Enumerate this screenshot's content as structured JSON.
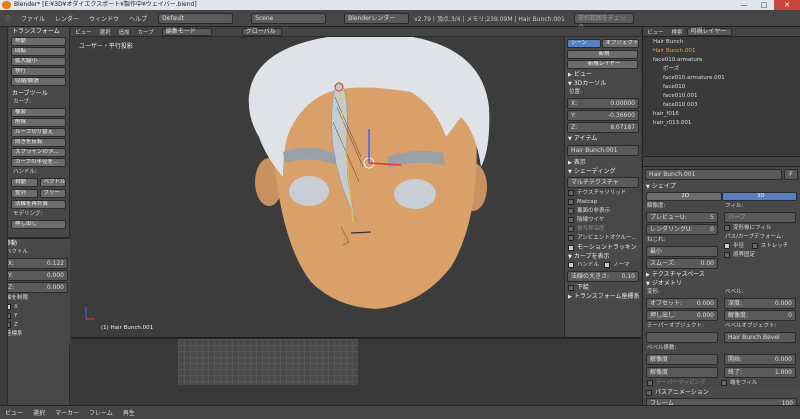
{
  "window": {
    "title": "Blender* [E:¥3D¥オダイエクスポート¥製作中¥ウェイバー.blend]",
    "min": "—",
    "max": "□",
    "close": "✕"
  },
  "menu": {
    "items": [
      "ファイル",
      "レンダー",
      "ウィンドウ",
      "ヘルプ"
    ],
    "layout": "Default",
    "scene": "Scene",
    "engine": "Blenderレンダー",
    "stats": "v2.79 | 頂点:3/4 | メモリ:239.09M | Hair Bunch.001",
    "mode_btn": "選択範囲をチェック"
  },
  "viewport": {
    "label": "ユーザー・平行投影",
    "object_label": "(1) Hair Bunch.001",
    "header_items": [
      "ビュー",
      "選択",
      "追加",
      "カーブ"
    ],
    "mode": "編集モード",
    "orientation": "グローバル"
  },
  "tool_shelf": {
    "header": "トランスフォーム",
    "transform": [
      "移動",
      "回転",
      "拡大縮小",
      "移行",
      "収縮/膨張"
    ],
    "curve_tools_header": "カーブツール",
    "curve_label": "カーブ:",
    "curve_buttons": [
      "複製",
      "削除",
      "ループ切り替え",
      "向きを反転",
      "スプラインのタ…",
      "カーブの半径を…"
    ],
    "handle_label": "ハンドル:",
    "handle_buttons": [
      "自動",
      "ベクトル",
      "整列",
      "フリー"
    ],
    "extra_buttons": [
      "法線を再計算",
      "モデリング:",
      "押し出し"
    ]
  },
  "operator_panel": {
    "header": "移動",
    "vector_label": "ベクトル",
    "x": "X:",
    "xv": "0.122",
    "y": "Y:",
    "yv": "0.000",
    "z": "Z:",
    "zv": "0.000",
    "constraint_label": "軸を制限",
    "axes": [
      "X",
      "Y",
      "Z"
    ],
    "orient_label": "座標系"
  },
  "view_panel": {
    "tabs": [
      "シーン",
      "オブジェクト"
    ],
    "new": "新規",
    "new_layer": "新規レイヤー",
    "view": "ビュー",
    "cursor": "3Dカーソル",
    "location": "位置:",
    "cx": "X:",
    "cxv": "0.00000",
    "cy": "Y:",
    "cyv": "-0.36600",
    "cz": "Z:",
    "czv": "8.07187",
    "item": "アイテム",
    "item_name": "Hair Bunch.001",
    "display": "表示",
    "shading": "シェーディング",
    "shading_mode": "マルチテクスチャ",
    "options": [
      "テクスチャソリッド",
      "Matcap",
      "裏面の非表示",
      "陰線ワイヤ",
      "被写界深度",
      "アンビエントオクルー..."
    ],
    "motion": "モーショントラッキン",
    "curve_display": "カーブを表示",
    "handles": "ハンドル",
    "normals": "ノーマ",
    "normal_size": "法線の大きさ:",
    "normal_size_val": "0.10",
    "background": "下絵",
    "transform_orient": "トランスフォーム座標系"
  },
  "outliner": {
    "header_items": [
      "ビュー",
      "検索",
      "可視レイヤー"
    ],
    "rows": [
      {
        "name": "Hair Bunch",
        "indent": 0
      },
      {
        "name": "Hair Bunch.001",
        "indent": 0
      },
      {
        "name": "face010.armature",
        "indent": 0
      },
      {
        "name": "ポーズ",
        "indent": 1
      },
      {
        "name": "face010.armature.001",
        "indent": 1
      },
      {
        "name": "face010",
        "indent": 1
      },
      {
        "name": "face010.001",
        "indent": 1
      },
      {
        "name": "face010.003",
        "indent": 1
      },
      {
        "name": "hair_f016",
        "indent": 0
      },
      {
        "name": "hair_r013.001",
        "indent": 0
      }
    ]
  },
  "properties": {
    "name": "Hair Bunch.001",
    "f": "F",
    "shape": "シェイプ",
    "d2": "2D",
    "d3": "3D",
    "resolution": "解像度:",
    "preview_u": "プレビューU:",
    "preview_u_v": "5",
    "render_u": "レンダリングU:",
    "render_u_v": "0",
    "fill": "フィル:",
    "fill_val": "ハーフ",
    "fill_deform": "変形後にフィル",
    "twist": "ねじれ:",
    "twist_val": "最小",
    "smooth": "スムーズ:",
    "smooth_v": "0.00",
    "path_deform": "パス/カーブデフォーム:",
    "radius": "半径",
    "stretch": "ストレッチ",
    "bounds": "境界固定",
    "texspace": "テクスチャスペース",
    "geometry": "ジオメトリ",
    "modify": "変形:",
    "offset": "オフセット:",
    "offset_v": "0.000",
    "extrude": "押し出し:",
    "extrude_v": "0.000",
    "bevel": "ベベル:",
    "depth": "深度:",
    "depth_v": "0.000",
    "resolution2": "解像度:",
    "res2_v": "0",
    "taper": "テーパーオブジェクト:",
    "bevel_obj": "ベベルオブジェクト:",
    "bevel_obj_val": "Hair Bunch Bevel",
    "bevel_factor": "ベベル係数:",
    "res_a": "解像度",
    "start": "開始:",
    "start_v": "0.000",
    "res_b": "解像度",
    "end": "終了:",
    "end_v": "1.000",
    "taper_map": "テーパーマッピング",
    "fill_caps": "端をフィル",
    "path_anim": "パスアニメーション",
    "frames": "フレーム",
    "frames_v": "100"
  },
  "status": {
    "items": [
      "ビュー",
      "選択",
      "マーカー",
      "フレーム",
      "再生"
    ]
  }
}
